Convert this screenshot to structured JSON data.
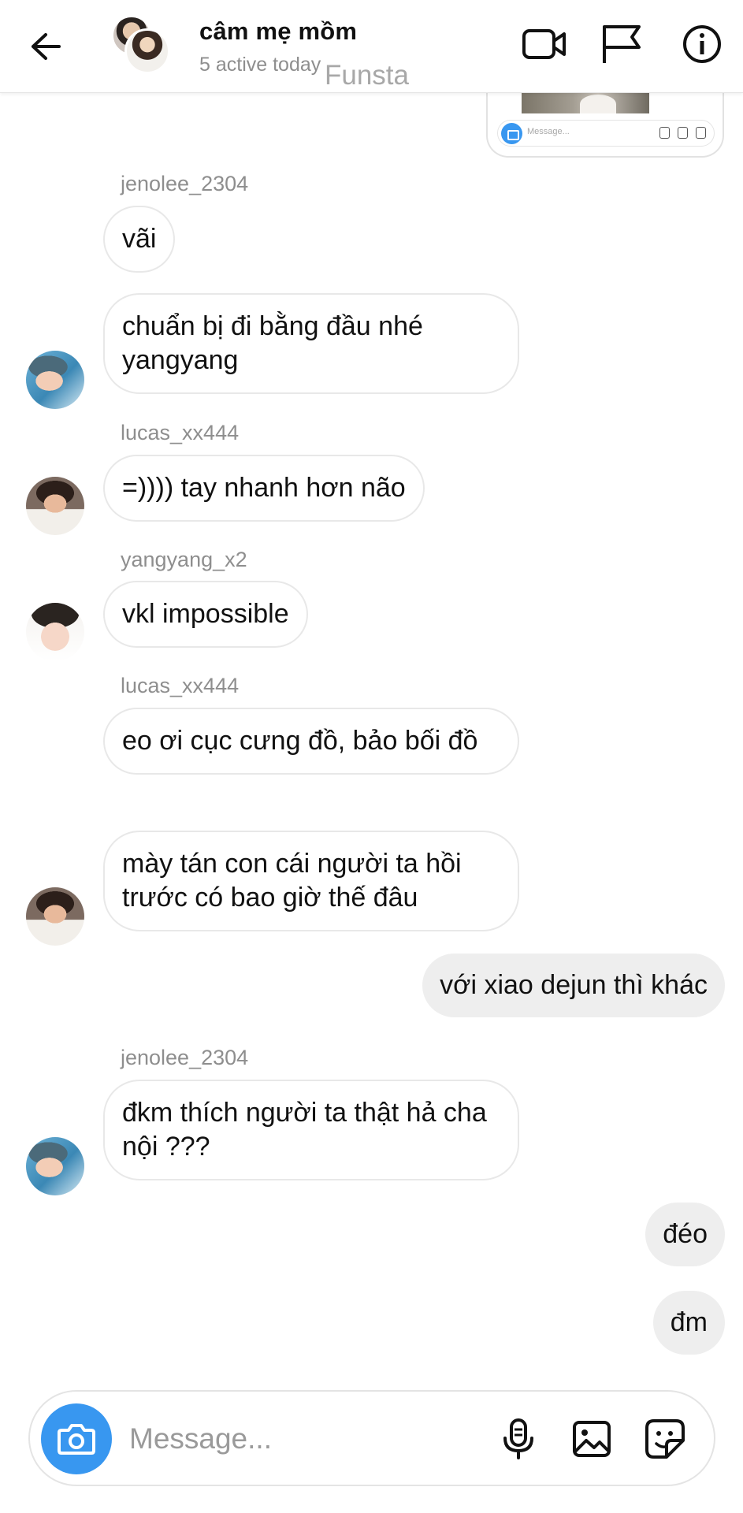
{
  "header": {
    "title": "câm mẹ mồm",
    "subtitle": "5 active today",
    "watermark": "Funsta"
  },
  "preview": {
    "input_placeholder": "Message..."
  },
  "messages": [
    {
      "sender": "jenolee_2304",
      "text": "vãi",
      "direction": "in"
    },
    {
      "text": "chuẩn bị đi bằng đầu nhé yangyang",
      "direction": "in",
      "avatar": "jenolee_2304"
    },
    {
      "sender": "lucas_xx444",
      "text": "=)))) tay nhanh hơn não",
      "direction": "in",
      "avatar": "lucas_xx444"
    },
    {
      "sender": "yangyang_x2",
      "text": "vkl impossible",
      "direction": "in",
      "avatar": "yangyang_x2"
    },
    {
      "sender": "lucas_xx444",
      "text": "eo ơi cục cưng đồ, bảo bối đồ",
      "direction": "in"
    },
    {
      "text": "mày tán con cái người ta hồi trước có bao giờ thế đâu",
      "direction": "in",
      "avatar": "lucas_xx444"
    },
    {
      "text": "với xiao dejun thì khác",
      "direction": "out"
    },
    {
      "sender": "jenolee_2304",
      "text": "đkm thích người ta thật hả cha nội ???",
      "direction": "in",
      "avatar": "jenolee_2304"
    },
    {
      "text": "đéo",
      "direction": "out"
    },
    {
      "text": "đm",
      "direction": "out"
    }
  ],
  "composer": {
    "placeholder": "Message..."
  },
  "colors": {
    "accent": "#3897f0",
    "outgoing_bubble": "#eeeeee",
    "incoming_border": "#e8e8e8",
    "secondary_text": "#8e8e8e"
  },
  "icons": {
    "back": "arrow-left-icon",
    "video": "video-camera-icon",
    "flag": "flag-icon",
    "info": "info-icon",
    "camera": "camera-icon",
    "mic": "microphone-icon",
    "gallery": "image-icon",
    "sticker": "sticker-icon"
  }
}
